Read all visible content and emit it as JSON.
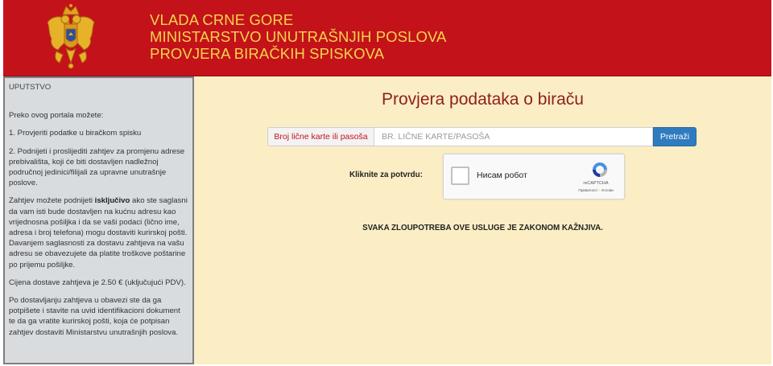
{
  "header": {
    "line1": "VLADA CRNE GORE",
    "line2": "MINISTARSTVO UNUTRAŠNJIH POSLOVA",
    "line3": "PROVJERA BIRAČKIH SPISKOVA",
    "emblem_icon": "montenegro-coat-of-arms-icon"
  },
  "sidebar": {
    "title": "UPUTSTVO",
    "intro": "Preko ovog portala možete:",
    "item1": "1. Provjeriti podatke u biračkom spisku",
    "item2": "2. Podnijeti i proslijediti zahtjev za promjenu adrese prebivališta, koji će biti dostavljen nadležnoj područnoj jedinici/filijali za upravne unutrašnje poslove.",
    "para3_before": "Zahtjev možete podnijeti ",
    "para3_bold": "isključivo",
    "para3_after": " ako ste saglasni da vam isti bude dostavljen na kućnu adresu kao vrijednosna pošiljka i da se vaši podaci (lično ime, adresa i broj telefona) mogu dostaviti kurirskoj pošti. Davanjem saglasnosti za dostavu zahtjeva na vašu adresu se obavezujete da platite troškove poštarine po prijemu pošiljke.",
    "para4": "Cijena dostave zahtjeva je 2.50 € (uključujući PDV).",
    "para5": "Po dostavljanju zahtjeva u obavezi ste da ga potpišete i stavite na uvid identifikacioni dokument te da ga vratite kurirskoj pošti, koja će potpisan zahtjev dostaviti Ministarstvu unutrašnjih poslova."
  },
  "main": {
    "title": "Provjera podataka o biraču",
    "search_label": "Broj lične karte ili pasoša",
    "search_placeholder": "BR. LIČNE KARTE/PASOŠA",
    "search_value": "",
    "search_button": "Pretraži",
    "confirm_label": "Kliknite za potvrdu:",
    "captcha_text": "Нисам робот",
    "captcha_brand": "reCAPTCHA",
    "captcha_links": "Приватност - Услови",
    "warning": "SVAKA ZLOUPOTREBA OVE USLUGE JE ZAKONOM KAŽNJIVA."
  },
  "colors": {
    "header_bg": "#c4121b",
    "header_text": "#f5d44a",
    "main_bg": "#fbeec4",
    "sidebar_bg": "#d8dcdf",
    "title_text": "#8e1f1c",
    "button_bg": "#2f7bbf"
  }
}
